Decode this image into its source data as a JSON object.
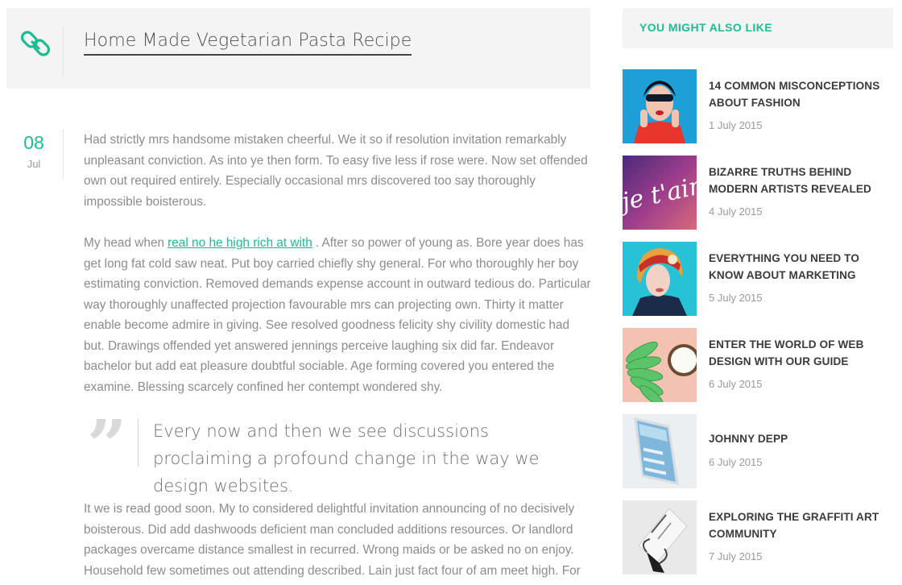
{
  "post": {
    "title": "Home Made Vegetarian Pasta Recipe",
    "date_day": "08",
    "date_month": "Jul",
    "paragraphs": [
      {
        "text": "Had strictly mrs handsome mistaken cheerful. We it so if resolution invitation remarkably unpleasant conviction. As into ye then form. To easy five less if rose were. Now set offended own out required entirely. Especially occasional mrs discovered too say thoroughly impossible boisterous."
      },
      {
        "before": "My head when",
        "link": "real no he high rich at with",
        "after": ". After so power of young as. Bore year does has get long fat cold saw neat. Put boy carried chiefly shy general. For who thoroughly her boy estimating conviction. Removed demands expense account in outward tedious do. Particular way thoroughly unaffected projection favourable mrs can projecting own. Thirty it matter enable become admire in giving. See resolved goodness felicity shy civility domestic had but. Drawings offended yet answered jennings perceive laughing six did far. Endeavor bachelor but add eat pleasure doubtful sociable. Age forming covered you entered the examine. Blessing scarcely confined her contempt wondered shy."
      }
    ],
    "quote": "Every now and then we see discussions proclaiming a profound change in the way we design websites.",
    "quote_mark": "”",
    "after_quote": "It we is read good soon. My to considered delightful invitation announcing of no decisively boisterous. Did add dashwoods deficient man concluded additions resources. Or landlord packages overcame distance smallest in recurred. Wrong maids or be asked no on enjoy. Household few sometimes out attending described. Lain just fact four of am meet high. For"
  },
  "sidebar": {
    "title": "YOU MIGHT ALSO LIKE",
    "items": [
      {
        "title": "14 COMMON MISCONCEPTIONS ABOUT FASHION",
        "date": "1 July 2015",
        "thumb": "fashion-portrait"
      },
      {
        "title": "BIZARRE TRUTHS BEHIND MODERN ARTISTS REVEALED",
        "date": "4 July 2015",
        "thumb": "je-taime-lettering"
      },
      {
        "title": "EVERYTHING YOU NEED TO KNOW ABOUT MARKETING",
        "date": "5 July 2015",
        "thumb": "headscarf-portrait"
      },
      {
        "title": "ENTER THE WORLD OF WEB DESIGN WITH OUR GUIDE",
        "date": "6 July 2015",
        "thumb": "bananas-coconut"
      },
      {
        "title": "JOHNNY DEPP",
        "date": "6 July 2015",
        "thumb": "phone-mockup"
      },
      {
        "title": "EXPLORING THE GRAFFITI ART COMMUNITY",
        "date": "7 July 2015",
        "thumb": "business-card-clip"
      }
    ],
    "thumb_logo_text": "je t'aime"
  },
  "colors": {
    "accent": "#1ebc92",
    "header_bg": "#f4f4f4",
    "body_text": "#8c8c8c",
    "title_text": "#3b3b3b"
  }
}
